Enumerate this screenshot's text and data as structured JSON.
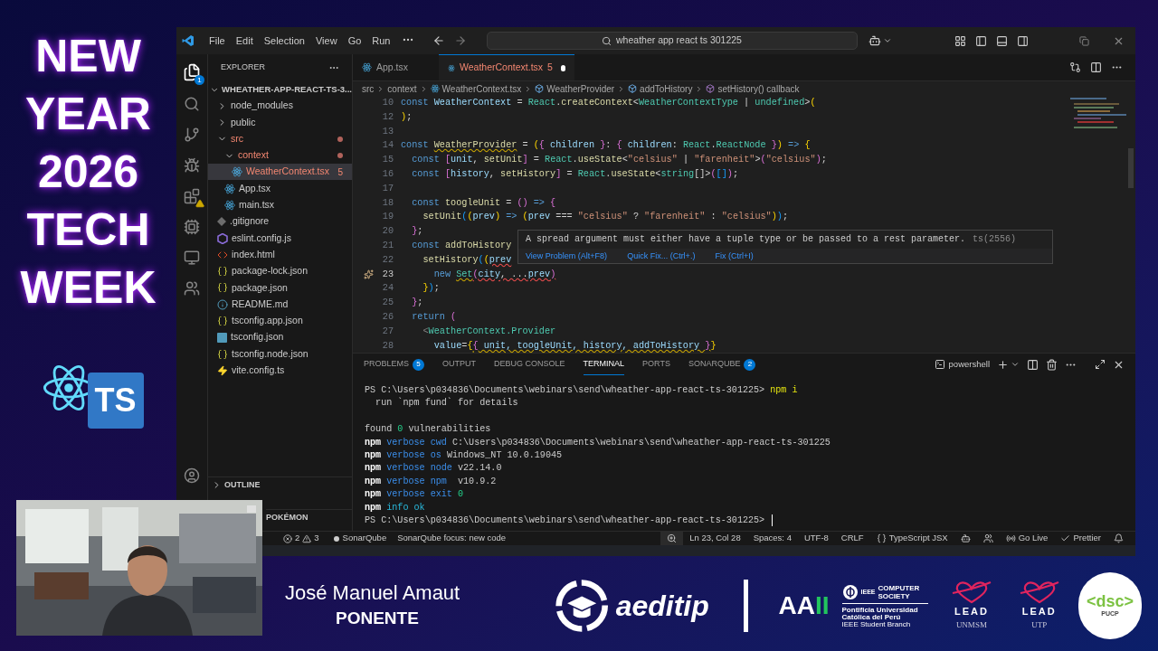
{
  "overlay": {
    "headline": [
      "NEW",
      "YEAR",
      "2026",
      "TECH",
      "WEEK"
    ],
    "badge": "TS"
  },
  "window": {
    "menu": [
      "File",
      "Edit",
      "Selection",
      "View",
      "Go",
      "Run"
    ],
    "search": "wheather app react ts 301225"
  },
  "activity_bar": {
    "explorer_badge": "1"
  },
  "explorer": {
    "title": "EXPLORER",
    "root": "WHEATHER-APP-REACT-TS-3...",
    "tree": [
      {
        "kind": "folder",
        "label": "node_modules",
        "expanded": false,
        "selected": false,
        "error": false,
        "modified": false
      },
      {
        "kind": "folder",
        "label": "public",
        "expanded": false,
        "selected": false,
        "error": false,
        "modified": false
      },
      {
        "kind": "folder",
        "label": "src",
        "expanded": true,
        "selected": false,
        "error": true,
        "modified": true,
        "children": [
          {
            "kind": "folder",
            "label": "context",
            "expanded": true,
            "selected": false,
            "error": true,
            "modified": true,
            "children": [
              {
                "kind": "react",
                "label": "WeatherContext.tsx",
                "badge": "5",
                "selected": true,
                "error": true,
                "modified": false
              }
            ]
          },
          {
            "kind": "react",
            "label": "App.tsx",
            "selected": false,
            "error": false,
            "modified": false
          },
          {
            "kind": "react",
            "label": "main.tsx",
            "selected": false,
            "error": false,
            "modified": false
          }
        ]
      },
      {
        "kind": "git",
        "label": ".gitignore",
        "selected": false,
        "error": false,
        "modified": false
      },
      {
        "kind": "eslint",
        "label": "eslint.config.js",
        "selected": false,
        "error": false,
        "modified": false
      },
      {
        "kind": "html",
        "label": "index.html",
        "selected": false,
        "error": false,
        "modified": false
      },
      {
        "kind": "json",
        "label": "package-lock.json",
        "selected": false,
        "error": false,
        "modified": false
      },
      {
        "kind": "json",
        "label": "package.json",
        "selected": false,
        "error": false,
        "modified": false
      },
      {
        "kind": "info",
        "label": "README.md",
        "selected": false,
        "error": false,
        "modified": false
      },
      {
        "kind": "json",
        "label": "tsconfig.app.json",
        "selected": false,
        "error": false,
        "modified": false
      },
      {
        "kind": "ts",
        "label": "tsconfig.json",
        "selected": false,
        "error": false,
        "modified": false
      },
      {
        "kind": "json",
        "label": "tsconfig.node.json",
        "selected": false,
        "error": false,
        "modified": false
      },
      {
        "kind": "vite",
        "label": "vite.config.ts",
        "selected": false,
        "error": false,
        "modified": false
      }
    ],
    "sections": [
      "OUTLINE",
      "POKÉMON"
    ]
  },
  "editor": {
    "tabs": [
      {
        "label": "App.tsx",
        "selected": false,
        "error": false,
        "dirty": false
      },
      {
        "label": "WeatherContext.tsx",
        "count": "5",
        "selected": true,
        "error": true,
        "dirty": true
      }
    ],
    "breadcrumb": [
      {
        "kind": "folder",
        "label": "src"
      },
      {
        "kind": "folder",
        "label": "context"
      },
      {
        "kind": "file",
        "label": "WeatherContext.tsx"
      },
      {
        "kind": "module",
        "label": "WeatherProvider"
      },
      {
        "kind": "method",
        "label": "addToHistory"
      },
      {
        "kind": "callback",
        "label": "setHistory() callback"
      }
    ],
    "lines": [
      {
        "number": "10",
        "active": false,
        "tokens": [
          {
            "kind": "kw",
            "text": "const "
          },
          {
            "kind": "var",
            "text": "WeatherContext"
          },
          {
            "kind": "plain",
            "text": " = "
          },
          {
            "kind": "type",
            "text": "React"
          },
          {
            "kind": "plain",
            "text": "."
          },
          {
            "kind": "fn",
            "text": "createContext"
          },
          {
            "kind": "plain",
            "text": "<"
          },
          {
            "kind": "type",
            "text": "WeatherContextType"
          },
          {
            "kind": "plain",
            "text": " | "
          },
          {
            "kind": "type",
            "text": "undefined"
          },
          {
            "kind": "plain",
            "text": ">"
          },
          {
            "kind": "br1",
            "text": "("
          }
        ]
      },
      {
        "number": "12",
        "active": false,
        "tokens": [
          {
            "kind": "br1",
            "text": ")"
          },
          {
            "kind": "plain",
            "text": ";"
          }
        ]
      },
      {
        "number": "13",
        "active": false
      },
      {
        "number": "14",
        "active": false,
        "tokens": [
          {
            "kind": "kw",
            "text": "const "
          },
          {
            "kind": "fn",
            "text": "WeatherProvider",
            "warning": true
          },
          {
            "kind": "plain",
            "text": " = "
          },
          {
            "kind": "br1",
            "text": "("
          },
          {
            "kind": "br2",
            "text": "{"
          },
          {
            "kind": "var",
            "text": " children "
          },
          {
            "kind": "br2",
            "text": "}"
          },
          {
            "kind": "plain",
            "text": ": "
          },
          {
            "kind": "br2",
            "text": "{"
          },
          {
            "kind": "var",
            "text": " children"
          },
          {
            "kind": "plain",
            "text": ": "
          },
          {
            "kind": "type",
            "text": "React"
          },
          {
            "kind": "plain",
            "text": "."
          },
          {
            "kind": "type",
            "text": "ReactNode "
          },
          {
            "kind": "br2",
            "text": "}"
          },
          {
            "kind": "br1",
            "text": ")"
          },
          {
            "kind": "kw",
            "text": " => "
          },
          {
            "kind": "br1",
            "text": "{"
          }
        ]
      },
      {
        "number": "15",
        "active": false,
        "tokens": [
          {
            "kind": "kw",
            "text": "  const "
          },
          {
            "kind": "br2",
            "text": "["
          },
          {
            "kind": "var",
            "text": "unit"
          },
          {
            "kind": "plain",
            "text": ", "
          },
          {
            "kind": "fn",
            "text": "setUnit"
          },
          {
            "kind": "br2",
            "text": "]"
          },
          {
            "kind": "plain",
            "text": " = "
          },
          {
            "kind": "type",
            "text": "React"
          },
          {
            "kind": "plain",
            "text": "."
          },
          {
            "kind": "fn",
            "text": "useState"
          },
          {
            "kind": "plain",
            "text": "<"
          },
          {
            "kind": "str",
            "text": "\"celsius\""
          },
          {
            "kind": "plain",
            "text": " | "
          },
          {
            "kind": "str",
            "text": "\"farenheit\""
          },
          {
            "kind": "plain",
            "text": ">"
          },
          {
            "kind": "br2",
            "text": "("
          },
          {
            "kind": "str",
            "text": "\"celsius\""
          },
          {
            "kind": "br2",
            "text": ")"
          },
          {
            "kind": "plain",
            "text": ";"
          }
        ]
      },
      {
        "number": "16",
        "active": false,
        "tokens": [
          {
            "kind": "kw",
            "text": "  const "
          },
          {
            "kind": "br2",
            "text": "["
          },
          {
            "kind": "var",
            "text": "history"
          },
          {
            "kind": "plain",
            "text": ", "
          },
          {
            "kind": "fn",
            "text": "setHistory"
          },
          {
            "kind": "br2",
            "text": "]"
          },
          {
            "kind": "plain",
            "text": " = "
          },
          {
            "kind": "type",
            "text": "React"
          },
          {
            "kind": "plain",
            "text": "."
          },
          {
            "kind": "fn",
            "text": "useState"
          },
          {
            "kind": "plain",
            "text": "<"
          },
          {
            "kind": "type",
            "text": "string"
          },
          {
            "kind": "plain",
            "text": "[]>"
          },
          {
            "kind": "br2",
            "text": "("
          },
          {
            "kind": "br3",
            "text": "[]"
          },
          {
            "kind": "br2",
            "text": ")"
          },
          {
            "kind": "plain",
            "text": ";"
          }
        ]
      },
      {
        "number": "17",
        "active": false
      },
      {
        "number": "18",
        "active": false,
        "tokens": [
          {
            "kind": "kw",
            "text": "  const "
          },
          {
            "kind": "fn",
            "text": "toogleUnit"
          },
          {
            "kind": "plain",
            "text": " = "
          },
          {
            "kind": "br2",
            "text": "()"
          },
          {
            "kind": "kw",
            "text": " => "
          },
          {
            "kind": "br2",
            "text": "{"
          }
        ]
      },
      {
        "number": "19",
        "active": false,
        "tokens": [
          {
            "kind": "fn",
            "text": "    setUnit"
          },
          {
            "kind": "br3",
            "text": "("
          },
          {
            "kind": "br1",
            "text": "("
          },
          {
            "kind": "var",
            "text": "prev"
          },
          {
            "kind": "br1",
            "text": ")"
          },
          {
            "kind": "kw",
            "text": " => "
          },
          {
            "kind": "br1",
            "text": "("
          },
          {
            "kind": "var",
            "text": "prev"
          },
          {
            "kind": "plain",
            "text": " === "
          },
          {
            "kind": "str",
            "text": "\"celsius\""
          },
          {
            "kind": "plain",
            "text": " ? "
          },
          {
            "kind": "str",
            "text": "\"farenheit\""
          },
          {
            "kind": "plain",
            "text": " : "
          },
          {
            "kind": "str",
            "text": "\"celsius\""
          },
          {
            "kind": "br1",
            "text": ")"
          },
          {
            "kind": "br3",
            "text": ")"
          },
          {
            "kind": "plain",
            "text": ";"
          }
        ]
      },
      {
        "number": "20",
        "active": false,
        "tokens": [
          {
            "kind": "br2",
            "text": "  }"
          },
          {
            "kind": "plain",
            "text": ";"
          }
        ]
      },
      {
        "number": "21",
        "active": false,
        "tokens": [
          {
            "kind": "kw",
            "text": "  const "
          },
          {
            "kind": "fn",
            "text": "addToHistory"
          }
        ]
      },
      {
        "number": "22",
        "active": false,
        "tokens": [
          {
            "kind": "fn",
            "text": "    setHistory"
          },
          {
            "kind": "br3",
            "text": "("
          },
          {
            "kind": "br1",
            "text": "("
          },
          {
            "kind": "var",
            "text": "prev",
            "error": true
          }
        ]
      },
      {
        "number": "23",
        "active": true,
        "tokens": [
          {
            "kind": "kw",
            "text": "      new "
          },
          {
            "kind": "type",
            "text": "Set",
            "warning": true
          },
          {
            "kind": "br2",
            "text": "(",
            "error": true
          },
          {
            "kind": "var",
            "text": "city",
            "error": true
          },
          {
            "kind": "plain",
            "text": ", ...",
            "error": true
          },
          {
            "kind": "var",
            "text": "prev",
            "error": true
          },
          {
            "kind": "br2",
            "text": ")",
            "error": true
          }
        ]
      },
      {
        "number": "24",
        "active": false,
        "tokens": [
          {
            "kind": "br1",
            "text": "    }"
          },
          {
            "kind": "br3",
            "text": ")"
          },
          {
            "kind": "plain",
            "text": ";"
          }
        ]
      },
      {
        "number": "25",
        "active": false,
        "tokens": [
          {
            "kind": "br2",
            "text": "  }"
          },
          {
            "kind": "plain",
            "text": ";"
          }
        ]
      },
      {
        "number": "26",
        "active": false,
        "tokens": [
          {
            "kind": "kw",
            "text": "  return "
          },
          {
            "kind": "br2",
            "text": "("
          }
        ]
      },
      {
        "number": "27",
        "active": false,
        "tokens": [
          {
            "kind": "tag",
            "text": "    <"
          },
          {
            "kind": "type",
            "text": "WeatherContext.Provider"
          }
        ]
      },
      {
        "number": "28",
        "active": false,
        "tokens": [
          {
            "kind": "var",
            "text": "      value"
          },
          {
            "kind": "plain",
            "text": "="
          },
          {
            "kind": "br1",
            "text": "{"
          },
          {
            "kind": "br2",
            "text": "{",
            "warning": true
          },
          {
            "kind": "var",
            "text": " unit, toogleUnit, history, addToHistory ",
            "warning": true
          },
          {
            "kind": "br2",
            "text": "}",
            "warning": true
          },
          {
            "kind": "br1",
            "text": "}"
          }
        ]
      }
    ],
    "hover": {
      "message": "A spread argument must either have a tuple type or be passed to a rest parameter.",
      "code": "ts(2556)",
      "actions": [
        "View Problem (Alt+F8)",
        "Quick Fix... (Ctrl+.)",
        "Fix (Ctrl+I)"
      ]
    }
  },
  "panel": {
    "tabs": [
      {
        "label": "PROBLEMS",
        "count": "5",
        "selected": false
      },
      {
        "label": "OUTPUT",
        "selected": false
      },
      {
        "label": "DEBUG CONSOLE",
        "selected": false
      },
      {
        "label": "TERMINAL",
        "selected": true
      },
      {
        "label": "PORTS",
        "selected": false
      },
      {
        "label": "SONARQUBE",
        "count": "2",
        "selected": false
      }
    ],
    "shell": "powershell",
    "terminal": [
      {
        "tokens": [
          {
            "kind": "plain",
            "text": "PS C:\\Users\\p034836\\Documents\\webinars\\send\\wheather-app-react-ts-301225> "
          },
          {
            "kind": "cmd",
            "text": "npm i"
          }
        ]
      },
      {
        "tokens": [
          {
            "kind": "plain",
            "text": "  run `npm fund` for details"
          }
        ]
      },
      {
        "blank_before": true,
        "tokens": [
          {
            "kind": "plain",
            "text": "found "
          },
          {
            "kind": "num",
            "text": "0"
          },
          {
            "kind": "plain",
            "text": " vulnerabilities"
          }
        ]
      },
      {
        "tokens": [
          {
            "kind": "npm",
            "text": "npm "
          },
          {
            "kind": "verbose",
            "text": "verbose cwd "
          },
          {
            "kind": "plain",
            "text": "C:\\Users\\p034836\\Documents\\webinars\\send\\wheather-app-react-ts-301225"
          }
        ]
      },
      {
        "tokens": [
          {
            "kind": "npm",
            "text": "npm "
          },
          {
            "kind": "verbose",
            "text": "verbose os "
          },
          {
            "kind": "plain",
            "text": "Windows_NT 10.0.19045"
          }
        ]
      },
      {
        "tokens": [
          {
            "kind": "npm",
            "text": "npm "
          },
          {
            "kind": "verbose",
            "text": "verbose node "
          },
          {
            "kind": "plain",
            "text": "v22.14.0"
          }
        ]
      },
      {
        "tokens": [
          {
            "kind": "npm",
            "text": "npm "
          },
          {
            "kind": "verbose",
            "text": "verbose npm  "
          },
          {
            "kind": "plain",
            "text": "v10.9.2"
          }
        ]
      },
      {
        "tokens": [
          {
            "kind": "npm",
            "text": "npm "
          },
          {
            "kind": "verbose",
            "text": "verbose exit "
          },
          {
            "kind": "num",
            "text": "0"
          }
        ]
      },
      {
        "tokens": [
          {
            "kind": "npm",
            "text": "npm "
          },
          {
            "kind": "info",
            "text": "info ok"
          }
        ]
      },
      {
        "tokens": [
          {
            "kind": "plain",
            "text": "PS C:\\Users\\p034836\\Documents\\webinars\\send\\wheather-app-react-ts-301225> "
          }
        ],
        "cursor": true
      }
    ]
  },
  "status_bar": {
    "errors": "2",
    "warnings": "3",
    "left": [
      {
        "kind": "sonar",
        "label": "SonarQube"
      },
      {
        "kind": "text",
        "label": "SonarQube focus: new code"
      }
    ],
    "right": [
      {
        "kind": "zoom"
      },
      {
        "kind": "text",
        "label": "Ln 23, Col 28"
      },
      {
        "kind": "text",
        "label": "Spaces: 4"
      },
      {
        "kind": "text",
        "label": "UTF-8"
      },
      {
        "kind": "text",
        "label": "CRLF"
      },
      {
        "kind": "braces",
        "label": "TypeScript JSX"
      },
      {
        "kind": "copilot"
      },
      {
        "kind": "accounts"
      },
      {
        "kind": "golive",
        "label": "Go Live"
      },
      {
        "kind": "check",
        "label": "Prettier"
      },
      {
        "kind": "bell"
      }
    ]
  },
  "footer": {
    "speaker": "José Manuel Amaut",
    "role": "PONENTE",
    "aeditip": "aeditip",
    "aaii": [
      "AA",
      "II"
    ],
    "ieee": {
      "top": "IEEE",
      "name": "COMPUTER SOCIETY",
      "branch": [
        "Pontificia Universidad",
        "Católica del Perú",
        "IEEE Student Branch"
      ]
    },
    "leads": [
      {
        "label": "LEAD",
        "sub": "UNMSM"
      },
      {
        "label": "LEAD",
        "sub": "UTP"
      }
    ],
    "dsc": {
      "mark": "<dsc>",
      "sub": "PUCP"
    }
  }
}
